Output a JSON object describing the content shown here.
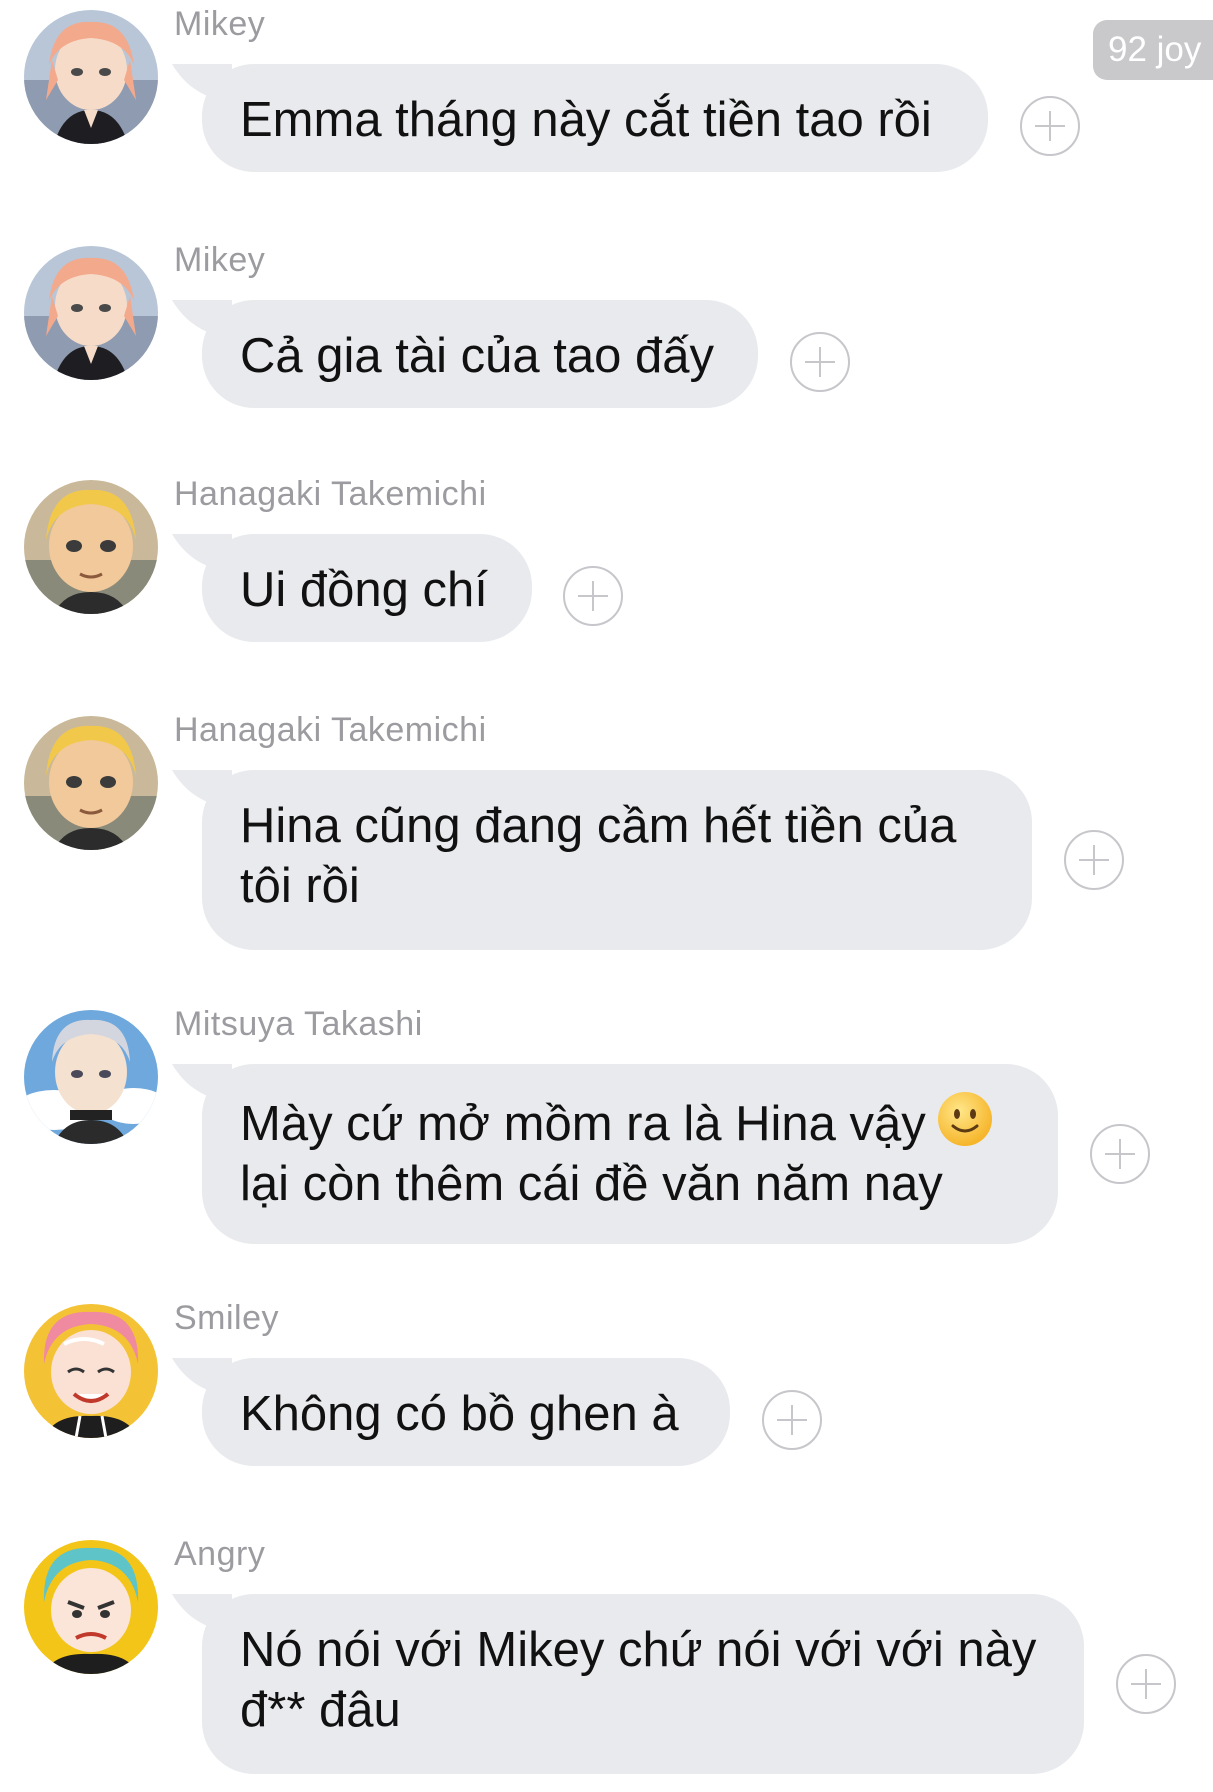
{
  "badge": {
    "text": "92 joy"
  },
  "messages": [
    {
      "sender": "Mikey",
      "avatar": "mikey-avatar",
      "lines": [
        "Emma tháng này cắt tiền tao rồi"
      ]
    },
    {
      "sender": "Mikey",
      "avatar": "mikey-avatar",
      "lines": [
        "Cả gia tài của tao đấy"
      ]
    },
    {
      "sender": "Hanagaki Takemichi",
      "avatar": "takemichi-avatar",
      "lines": [
        "Ui đồng chí"
      ]
    },
    {
      "sender": "Hanagaki Takemichi",
      "avatar": "takemichi-avatar",
      "lines": [
        "Hina cũng đang cầm hết tiền của",
        "tôi rồi"
      ]
    },
    {
      "sender": "Mitsuya Takashi",
      "avatar": "mitsuya-avatar",
      "lines": [
        "Mày cứ mở mồm ra là Hina vậy",
        "lại còn thêm cái đề văn năm nay"
      ],
      "emoji": "slightly-smiling-face-emoji"
    },
    {
      "sender": "Smiley",
      "avatar": "smiley-avatar",
      "lines": [
        "Không có bồ ghen à"
      ]
    },
    {
      "sender": "Angry",
      "avatar": "angry-avatar",
      "lines": [
        "Nó nói với Mikey chứ nói với với này",
        "đ** đâu"
      ]
    }
  ],
  "colors": {
    "bubble": "#e9eaee",
    "sender_text": "#9b9ba0",
    "message_text": "#111111",
    "badge_bg": "#c9c9cc",
    "add_icon": "#c6c6cb"
  },
  "icons": {
    "add_reaction": "add-reaction-icon"
  }
}
